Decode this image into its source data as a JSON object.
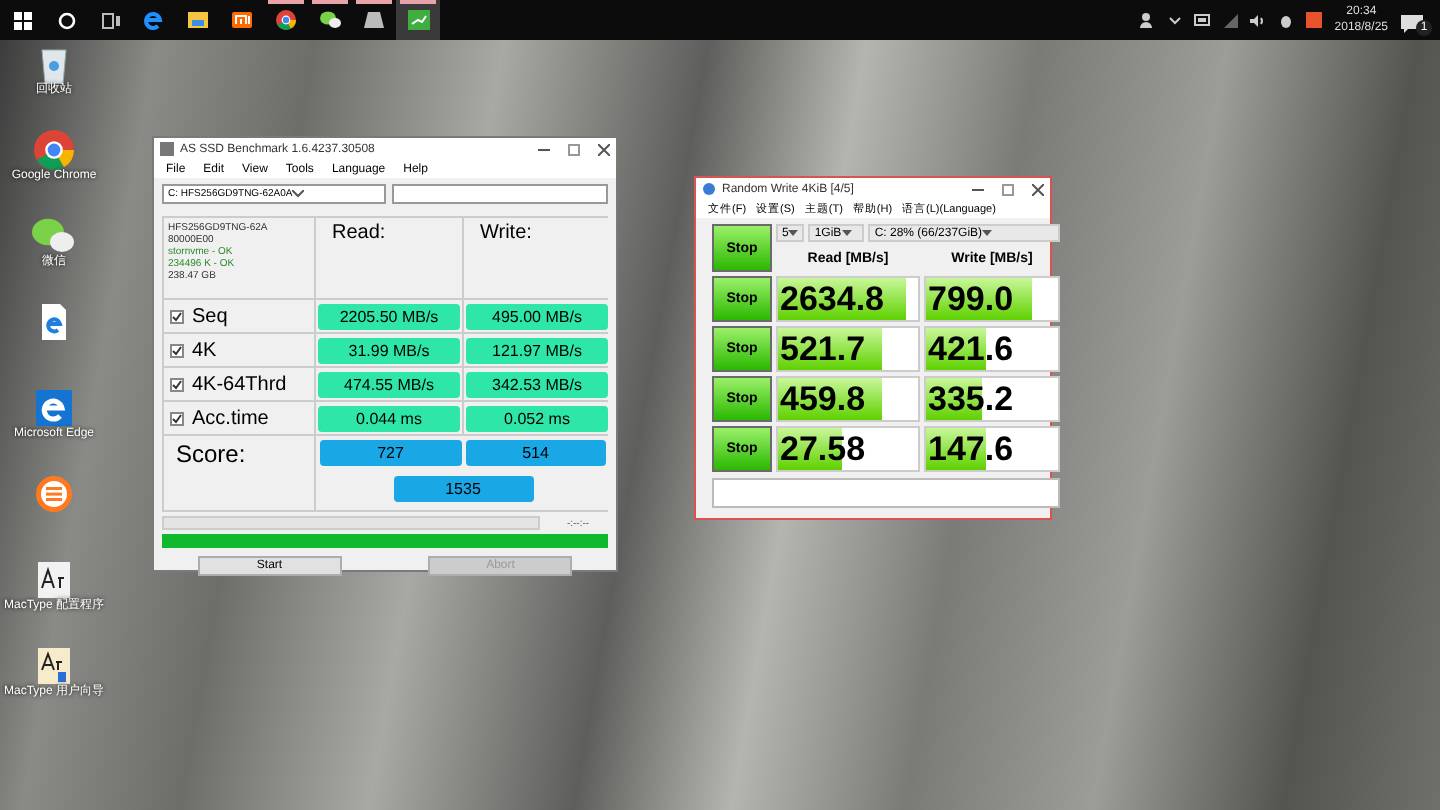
{
  "taskbar": {
    "system": [
      {
        "kind": "windows"
      },
      {
        "kind": "cortana"
      },
      {
        "kind": "taskview"
      }
    ],
    "apps": [
      {
        "kind": "edge",
        "running": false,
        "active": false
      },
      {
        "kind": "folder",
        "running": false,
        "active": false
      },
      {
        "kind": "mi",
        "running": false,
        "active": false
      },
      {
        "kind": "chrome",
        "running": true,
        "active": false
      },
      {
        "kind": "wechat",
        "running": true,
        "active": false
      },
      {
        "kind": "drive",
        "running": true,
        "active": false
      },
      {
        "kind": "benchmark",
        "running": true,
        "active": true
      }
    ],
    "tray": {
      "time": "20:34",
      "date": "2018/8/25",
      "notifications": "1"
    }
  },
  "desktop_icons": [
    {
      "kind": "recycle",
      "label": "回收站"
    },
    {
      "kind": "chrome",
      "label": "Google Chrome"
    },
    {
      "kind": "wechat",
      "label": "微信"
    },
    {
      "kind": "edgefile"
    },
    {
      "kind": "edge",
      "label": "Microsoft Edge"
    },
    {
      "kind": "music"
    },
    {
      "kind": "mactype",
      "label": "MacType 配置程序"
    },
    {
      "kind": "mactype2",
      "label": "MacType 用户向导"
    }
  ],
  "as_ssd": {
    "title": "AS SSD Benchmark 1.6.4237.30508",
    "menu": [
      "File",
      "Edit",
      "View",
      "Tools",
      "Language",
      "Help"
    ],
    "drive": "C:  HFS256GD9TNG-62A0A",
    "info": [
      {
        "text": "HFS256GD9TNG-62A",
        "ok": false
      },
      {
        "text": "80000E00",
        "ok": false
      },
      {
        "text": "stornvme - OK",
        "ok": true
      },
      {
        "text": "234496 K - OK",
        "ok": true
      },
      {
        "text": "238.47 GB",
        "ok": false
      }
    ],
    "read_header": "Read:",
    "write_header": "Write:",
    "rows": [
      {
        "name": "Seq",
        "checked": true,
        "read": "2205.50 MB/s",
        "write": "495.00 MB/s"
      },
      {
        "name": "4K",
        "checked": true,
        "read": "31.99 MB/s",
        "write": "121.97 MB/s"
      },
      {
        "name": "4K-64Thrd",
        "checked": true,
        "read": "474.55 MB/s",
        "write": "342.53 MB/s"
      },
      {
        "name": "Acc.time",
        "checked": true,
        "read": "0.044 ms",
        "write": "0.052 ms"
      }
    ],
    "score_label": "Score:",
    "score_read": "727",
    "score_write": "514",
    "score_total": "1535",
    "timer": "-:--:--",
    "test_progress": {
      "level": 0
    },
    "progress": {
      "level": 1
    },
    "buttons": [
      {
        "label": "Start",
        "disabled": false
      },
      {
        "label": "Abort",
        "disabled": true
      }
    ]
  },
  "crystal": {
    "title": "Random Write 4KiB [4/5]",
    "menu": [
      "文件(F)",
      "设置(S)",
      "主题(T)",
      "帮助(H)",
      "语言(L)(Language)"
    ],
    "all_button": "Stop",
    "count": "5",
    "size": "1GiB",
    "drive": "C: 28% (66/237GiB)",
    "read_header": "Read [MB/s]",
    "write_header": "Write [MB/s]",
    "rows": [
      {
        "button": "Stop",
        "read": {
          "value": "2634.8",
          "level": 0.92
        },
        "write": {
          "value": "799.0",
          "level": 0.8
        }
      },
      {
        "button": "Stop",
        "read": {
          "value": "521.7",
          "level": 0.74
        },
        "write": {
          "value": "421.6",
          "level": 0.45
        }
      },
      {
        "button": "Stop",
        "read": {
          "value": "459.8",
          "level": 0.74
        },
        "write": {
          "value": "335.2",
          "level": 0.42
        }
      },
      {
        "button": "Stop",
        "read": {
          "value": "27.58",
          "level": 0.46
        },
        "write": {
          "value": "147.6",
          "level": 0.46
        }
      }
    ]
  }
}
